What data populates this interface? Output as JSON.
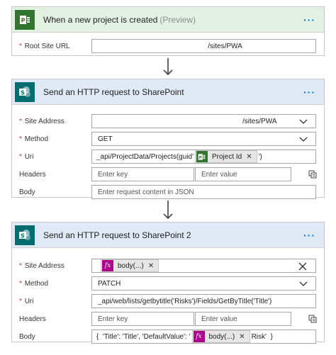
{
  "card1": {
    "title": "When a new project is created",
    "preview": "(Preview)",
    "site_label": "Root Site URL",
    "site_value": "/sites/PWA"
  },
  "card2": {
    "title": "Send an HTTP request to SharePoint",
    "site_address_label": "Site Address",
    "site_address_value": "/sites/PWA",
    "method_label": "Method",
    "method_value": "GET",
    "uri_label": "Uri",
    "uri_prefix": "_api/ProjectData/Projects(guid'",
    "uri_token": "Project Id",
    "uri_suffix": "')",
    "headers_label": "Headers",
    "key_placeholder": "Enter key",
    "value_placeholder": "Enter value",
    "body_label": "Body",
    "body_placeholder": "Enter request content in JSON"
  },
  "card3": {
    "title": "Send an HTTP request to SharePoint 2",
    "site_address_label": "Site Address",
    "site_token": "body(...)",
    "method_label": "Method",
    "method_value": "PATCH",
    "uri_label": "Uri",
    "uri_value": "_api/web/lists/getbytitle('Risks')/Fields/GetByTitle('Title')",
    "headers_label": "Headers",
    "key_placeholder": "Enter key",
    "value_placeholder": "Enter value",
    "body_label": "Body",
    "body_prefix": "{  'Title': 'Title', 'DefaultValue': '",
    "body_token": "body(...)",
    "body_suffix": "Risk'  }"
  },
  "icons": {
    "more": "more-options-icon",
    "project": "project-icon",
    "sharepoint": "sharepoint-icon",
    "fx": "fx-expression-icon"
  },
  "colors": {
    "project_green": "#31752f",
    "sharepoint_teal": "#036c70",
    "fx_magenta": "#ad008c",
    "accent_blue": "#0078d4",
    "required_red": "#c8372a"
  }
}
